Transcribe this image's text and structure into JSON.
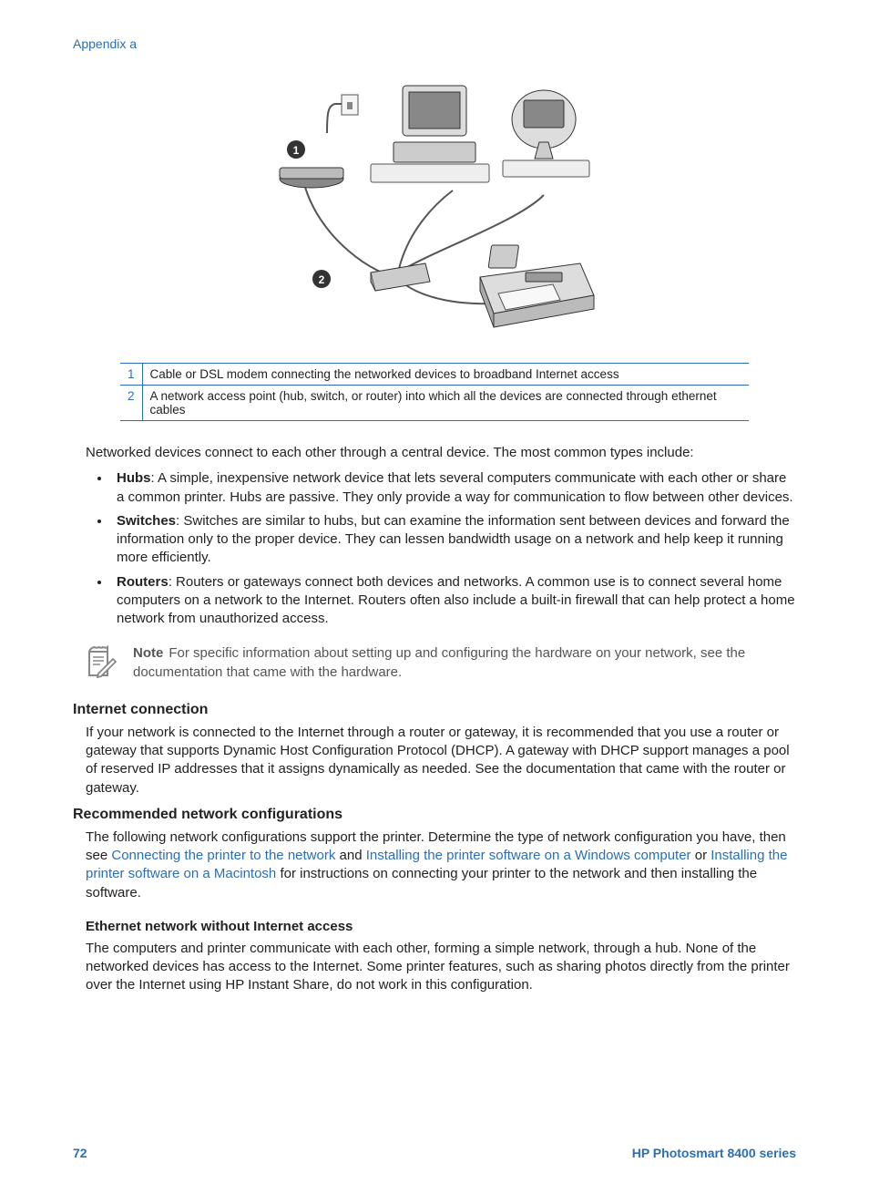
{
  "header": {
    "appendix": "Appendix a"
  },
  "legend": {
    "rows": [
      {
        "num": "1",
        "text": "Cable or DSL modem connecting the networked devices to broadband Internet access"
      },
      {
        "num": "2",
        "text": "A network access point (hub, switch, or router) into which all the devices are connected through ethernet cables"
      }
    ]
  },
  "intro": "Networked devices connect to each other through a central device. The most common types include:",
  "bullets": [
    {
      "label": "Hubs",
      "text": ": A simple, inexpensive network device that lets several computers communicate with each other or share a common printer. Hubs are passive. They only provide a way for communication to flow between other devices."
    },
    {
      "label": "Switches",
      "text": ": Switches are similar to hubs, but can examine the information sent between devices and forward the information only to the proper device. They can lessen bandwidth usage on a network and help keep it running more efficiently."
    },
    {
      "label": "Routers",
      "text": ": Routers or gateways connect both devices and networks. A common use is to connect several home computers on a network to the Internet. Routers often also include a built-in firewall that can help protect a home network from unauthorized access."
    }
  ],
  "note": {
    "label": "Note",
    "text": "For specific information about setting up and configuring the hardware on your network, see the documentation that came with the hardware."
  },
  "sections": {
    "internet": {
      "heading": "Internet connection",
      "text": "If your network is connected to the Internet through a router or gateway, it is recommended that you use a router or gateway that supports Dynamic Host Configuration Protocol (DHCP). A gateway with DHCP support manages a pool of reserved IP addresses that it assigns dynamically as needed. See the documentation that came with the router or gateway."
    },
    "recommended": {
      "heading": "Recommended network configurations",
      "pre": "The following network configurations support the printer. Determine the type of network configuration you have, then see ",
      "link1": "Connecting the printer to the network",
      "mid1": " and ",
      "link2": "Installing the printer software on a Windows computer",
      "mid2": " or ",
      "link3": "Installing the printer software on a Macintosh",
      "post": " for instructions on connecting your printer to the network and then installing the software."
    },
    "ethernet": {
      "heading": "Ethernet network without Internet access",
      "text": "The computers and printer communicate with each other, forming a simple network, through a hub. None of the networked devices has access to the Internet. Some printer features, such as sharing photos directly from the printer over the Internet using HP Instant Share, do not work in this configuration."
    }
  },
  "footer": {
    "page": "72",
    "title": "HP Photosmart 8400 series"
  }
}
